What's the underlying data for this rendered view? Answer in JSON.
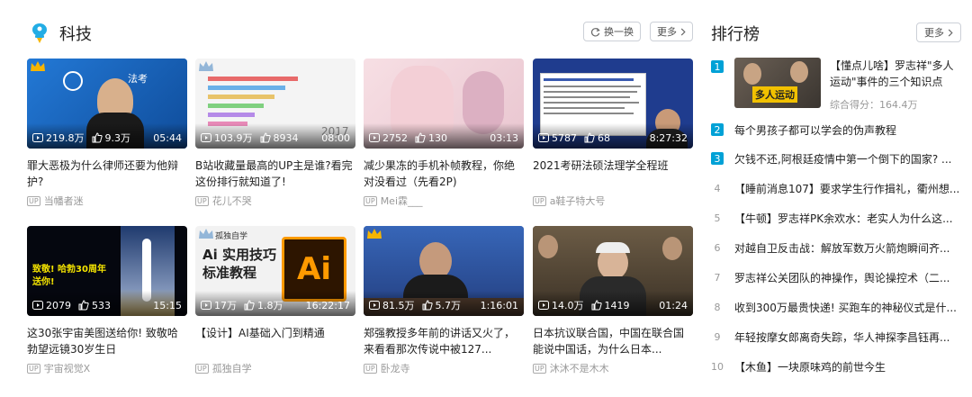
{
  "section": {
    "title": "科技",
    "shuffle_label": "换一换",
    "more_label": "更多"
  },
  "videos": [
    {
      "title": "罪大恶极为什么律师还要为他辩护?",
      "up": "当幡者迷",
      "views": "219.8万",
      "likes": "9.3万",
      "duration": "05:44",
      "thumb_text": "法考"
    },
    {
      "title": "B站收藏量最高的UP主是谁?看完这份排行就知道了!",
      "up": "花儿不哭",
      "views": "103.9万",
      "likes": "8934",
      "duration": "08:00",
      "thumb_text": "2017"
    },
    {
      "title": "减少果冻的手机补帧教程，你绝对没看过（先看2P)",
      "up": "Mei霖___",
      "views": "2752",
      "likes": "130",
      "duration": "03:13",
      "thumb_text": ""
    },
    {
      "title": "2021考研法硕法理学全程班",
      "up": "a鞋子特大号",
      "views": "5787",
      "likes": "68",
      "duration": "8:27:32",
      "thumb_text": ""
    },
    {
      "title": "这30张宇宙美图送给你! 致敬哈勃望远镜30岁生日",
      "up": "宇宙视觉X",
      "views": "2079",
      "likes": "533",
      "duration": "15:15",
      "thumb_text": "致敬! 哈勃30周年 送你!"
    },
    {
      "title": "【设计】AI基础入门到精通",
      "up": "孤独自学",
      "views": "17万",
      "likes": "1.8万",
      "duration": "16:22:17",
      "thumb_text": "Ai 实用技巧 标准教程",
      "thumb_brand": "孤独自学",
      "thumb_logo": "Ai"
    },
    {
      "title": "郑强教授多年前的讲话又火了，来看看那次传说中被127...",
      "up": "卧龙寺",
      "views": "81.5万",
      "likes": "5.7万",
      "duration": "1:16:01",
      "thumb_text": ""
    },
    {
      "title": "日本抗议联合国，中国在联合国能说中国话，为什么日本...",
      "up": "沐沐不是木木",
      "views": "14.0万",
      "likes": "1419",
      "duration": "01:24",
      "thumb_text": ""
    }
  ],
  "ranking": {
    "title": "排行榜",
    "more_label": "更多",
    "first": {
      "num": "1",
      "title": "【懂点儿啥】罗志祥\"多人运动\"事件的三个知识点",
      "score": "综合得分：164.4万",
      "thumb_text": "多人运动"
    },
    "items": [
      {
        "num": "2",
        "text": "每个男孩子都可以学会的伪声教程"
      },
      {
        "num": "3",
        "text": "欠钱不还,阿根廷疫情中第一个倒下的国家? ..."
      },
      {
        "num": "4",
        "text": "【睡前消息107】要求学生行作揖礼，衢州想..."
      },
      {
        "num": "5",
        "text": "【牛顿】罗志祥PK余欢水：老实人为什么这..."
      },
      {
        "num": "6",
        "text": "对越自卫反击战：解放军数万火箭炮瞬间齐..."
      },
      {
        "num": "7",
        "text": "罗志祥公关团队的神操作，舆论操控术（二..."
      },
      {
        "num": "8",
        "text": "收到300万最贵快递! 买跑车的神秘仪式是什..."
      },
      {
        "num": "9",
        "text": "年轻按摩女郎离奇失踪，华人神探李昌钰再..."
      },
      {
        "num": "10",
        "text": "【木鱼】一块原味鸡的前世今生"
      }
    ]
  },
  "colors": {
    "accent": "#00a1d6",
    "text": "#212121",
    "muted": "#999999"
  }
}
